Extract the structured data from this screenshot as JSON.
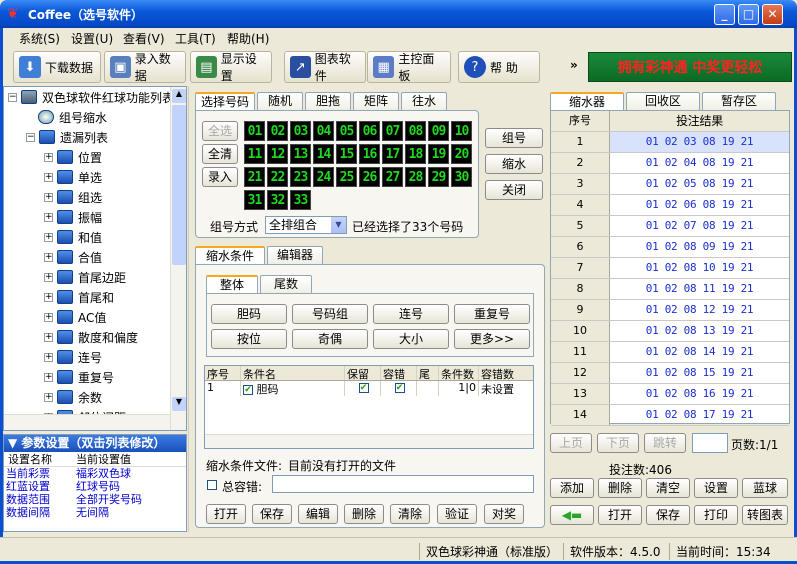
{
  "window": {
    "title": "Coffee（选号软件）"
  },
  "menu": [
    "系统(S)",
    "设置(U)",
    "查看(V)",
    "工具(T)",
    "帮助(H)"
  ],
  "toolbar": {
    "download": "下载数据",
    "entry": "录入数据",
    "display": "显示设置",
    "chart": "图表软件",
    "control": "主控面板",
    "help": "帮 助",
    "more": "»",
    "banner": "拥有彩神通 中奖更轻松"
  },
  "tree": {
    "root": "双色球软件红球功能列表",
    "item_group": "组号缩水",
    "omit": "遗漏列表",
    "children": [
      "位置",
      "单选",
      "组选",
      "振幅",
      "和值",
      "合值",
      "首尾边距",
      "首尾和",
      "AC值",
      "散度和偏度",
      "连号",
      "重复号",
      "余数",
      "邻位间距"
    ]
  },
  "params": {
    "title": "▼ 参数设置（双击列表修改）",
    "col1": "设置名称",
    "col2": "当前设置值",
    "rows": [
      [
        "当前彩票",
        "福彩双色球"
      ],
      [
        "红蓝设置",
        "红球号码"
      ],
      [
        "数据范围",
        "全部开奖号码"
      ],
      [
        "数据间隔",
        "无间隔"
      ]
    ]
  },
  "select": {
    "tabs": [
      "选择号码",
      "随机",
      "胆拖",
      "矩阵",
      "往水"
    ],
    "btn_all": "全选",
    "btn_clear": "全清",
    "btn_input": "录入",
    "numbers": [
      "01",
      "02",
      "03",
      "04",
      "05",
      "06",
      "07",
      "08",
      "09",
      "10",
      "11",
      "12",
      "13",
      "14",
      "15",
      "16",
      "17",
      "18",
      "19",
      "20",
      "21",
      "22",
      "23",
      "24",
      "25",
      "26",
      "27",
      "28",
      "29",
      "30",
      "31",
      "32",
      "33"
    ],
    "mode_label": "组号方式",
    "mode_value": "全排组合",
    "status": "已经选择了33个号码",
    "side_btns": [
      "组号",
      "缩水",
      "关闭"
    ]
  },
  "filter": {
    "tabs": [
      "缩水条件",
      "编辑器"
    ],
    "subtabs": [
      "整体",
      "尾数"
    ],
    "grid_btns": [
      "胆码",
      "号码组",
      "连号",
      "重复号",
      "按位",
      "奇偶",
      "大小",
      "更多>>"
    ],
    "columns": [
      "序号",
      "条件名",
      "保留",
      "容错",
      "尾",
      "条件数",
      "容错数"
    ],
    "rows": [
      {
        "no": "1",
        "name": "胆码",
        "count": "1",
        "tolerance": "0",
        "tol_value": "未设置"
      }
    ],
    "file_label": "缩水条件文件:",
    "file_status": "目前没有打开的文件",
    "total_tol": "总容错:",
    "bottom_btns": [
      "打开",
      "保存",
      "编辑",
      "删除",
      "清除",
      "验证",
      "对奖"
    ]
  },
  "results": {
    "tabs": [
      "缩水器",
      "回收区",
      "暂存区"
    ],
    "col_no": "序号",
    "col_res": "投注结果",
    "rows": [
      [
        "1",
        "01 02 03 08 19 21"
      ],
      [
        "2",
        "01 02 04 08 19 21"
      ],
      [
        "3",
        "01 02 05 08 19 21"
      ],
      [
        "4",
        "01 02 06 08 19 21"
      ],
      [
        "5",
        "01 02 07 08 19 21"
      ],
      [
        "6",
        "01 02 08 09 19 21"
      ],
      [
        "7",
        "01 02 08 10 19 21"
      ],
      [
        "8",
        "01 02 08 11 19 21"
      ],
      [
        "9",
        "01 02 08 12 19 21"
      ],
      [
        "10",
        "01 02 08 13 19 21"
      ],
      [
        "11",
        "01 02 08 14 19 21"
      ],
      [
        "12",
        "01 02 08 15 19 21"
      ],
      [
        "13",
        "01 02 08 16 19 21"
      ],
      [
        "14",
        "01 02 08 17 19 21"
      ]
    ],
    "nav": [
      "上页",
      "下页",
      "跳转"
    ],
    "pages": "页数:1/1",
    "count": "投注数:406",
    "row1": [
      "添加",
      "删除",
      "清空",
      "设置",
      "蓝球"
    ],
    "row2": [
      "打开",
      "保存",
      "打印",
      "转图表"
    ]
  },
  "status": {
    "product": "双色球彩神通（标准版）",
    "version": "软件版本：4.5.0",
    "time": "当前时间：15:34"
  }
}
